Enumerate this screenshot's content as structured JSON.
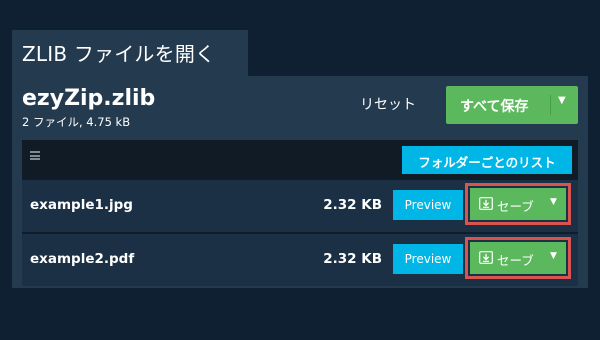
{
  "tab": {
    "title": "ZLIB ファイルを開く"
  },
  "archive": {
    "name": "ezyZip.zlib",
    "info": "2 ファイル, 4.75 kB"
  },
  "toolbar": {
    "reset_label": "リセット",
    "save_all_label": "すべて保存",
    "folder_list_label": "フォルダーごとのリスト"
  },
  "files": [
    {
      "name": "example1.jpg",
      "size": "2.32 KB",
      "preview_label": "Preview",
      "save_label": "セーブ"
    },
    {
      "name": "example2.pdf",
      "size": "2.32 KB",
      "preview_label": "Preview",
      "save_label": "セーブ"
    }
  ],
  "icons": {
    "menu": "hamburger-menu-icon",
    "download": "download-icon",
    "caret": "caret-down-icon"
  },
  "colors": {
    "background": "#0f2033",
    "panel": "#243a4f",
    "green": "#5cb85c",
    "cyan": "#00b6e6",
    "highlight_border": "#d9534f"
  }
}
